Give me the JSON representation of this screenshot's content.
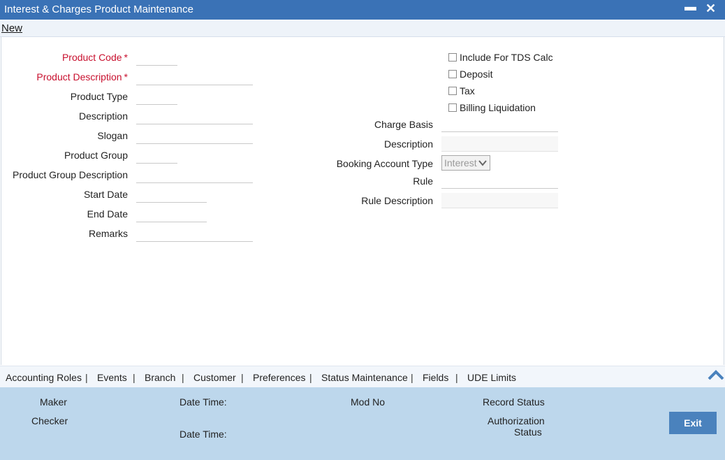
{
  "window": {
    "title": "Interest & Charges Product Maintenance",
    "minimize": "▬",
    "close": "✕"
  },
  "toolbar": {
    "new_label": "New"
  },
  "form": {
    "left": [
      {
        "label": "Product Code",
        "required": "*"
      },
      {
        "label": "Product Description",
        "required": "*"
      },
      {
        "label": "Product Type"
      },
      {
        "label": "Description"
      },
      {
        "label": "Slogan"
      },
      {
        "label": "Product Group"
      },
      {
        "label": "Product Group Description"
      },
      {
        "label": "Start Date"
      },
      {
        "label": "End Date"
      },
      {
        "label": "Remarks"
      }
    ],
    "checkboxes": [
      {
        "label": "Include For TDS Calc"
      },
      {
        "label": "Deposit"
      },
      {
        "label": "Tax"
      },
      {
        "label": "Billing Liquidation"
      }
    ],
    "right": {
      "charge_basis": "Charge Basis",
      "description": "Description",
      "booking_account_type": "Booking Account Type",
      "booking_account_value": "Interest",
      "rule": "Rule",
      "rule_description": "Rule Description"
    }
  },
  "tabs": [
    "Accounting Roles",
    "Events",
    "Branch",
    "Customer",
    "Preferences",
    "Status Maintenance",
    "Fields",
    "UDE Limits"
  ],
  "tab_separator": "|",
  "footer": {
    "maker": "Maker",
    "checker": "Checker",
    "date_time_1": "Date Time:",
    "date_time_2": "Date Time:",
    "mod_no": "Mod No",
    "record_status": "Record Status",
    "authorization_status_1": "Authorization",
    "authorization_status_2": "Status",
    "exit_label": "Exit"
  },
  "colors": {
    "titlebar": "#3a72b6",
    "required": "#c8102e",
    "footer": "#bdd7ec",
    "exit_button": "#4a82bd"
  }
}
